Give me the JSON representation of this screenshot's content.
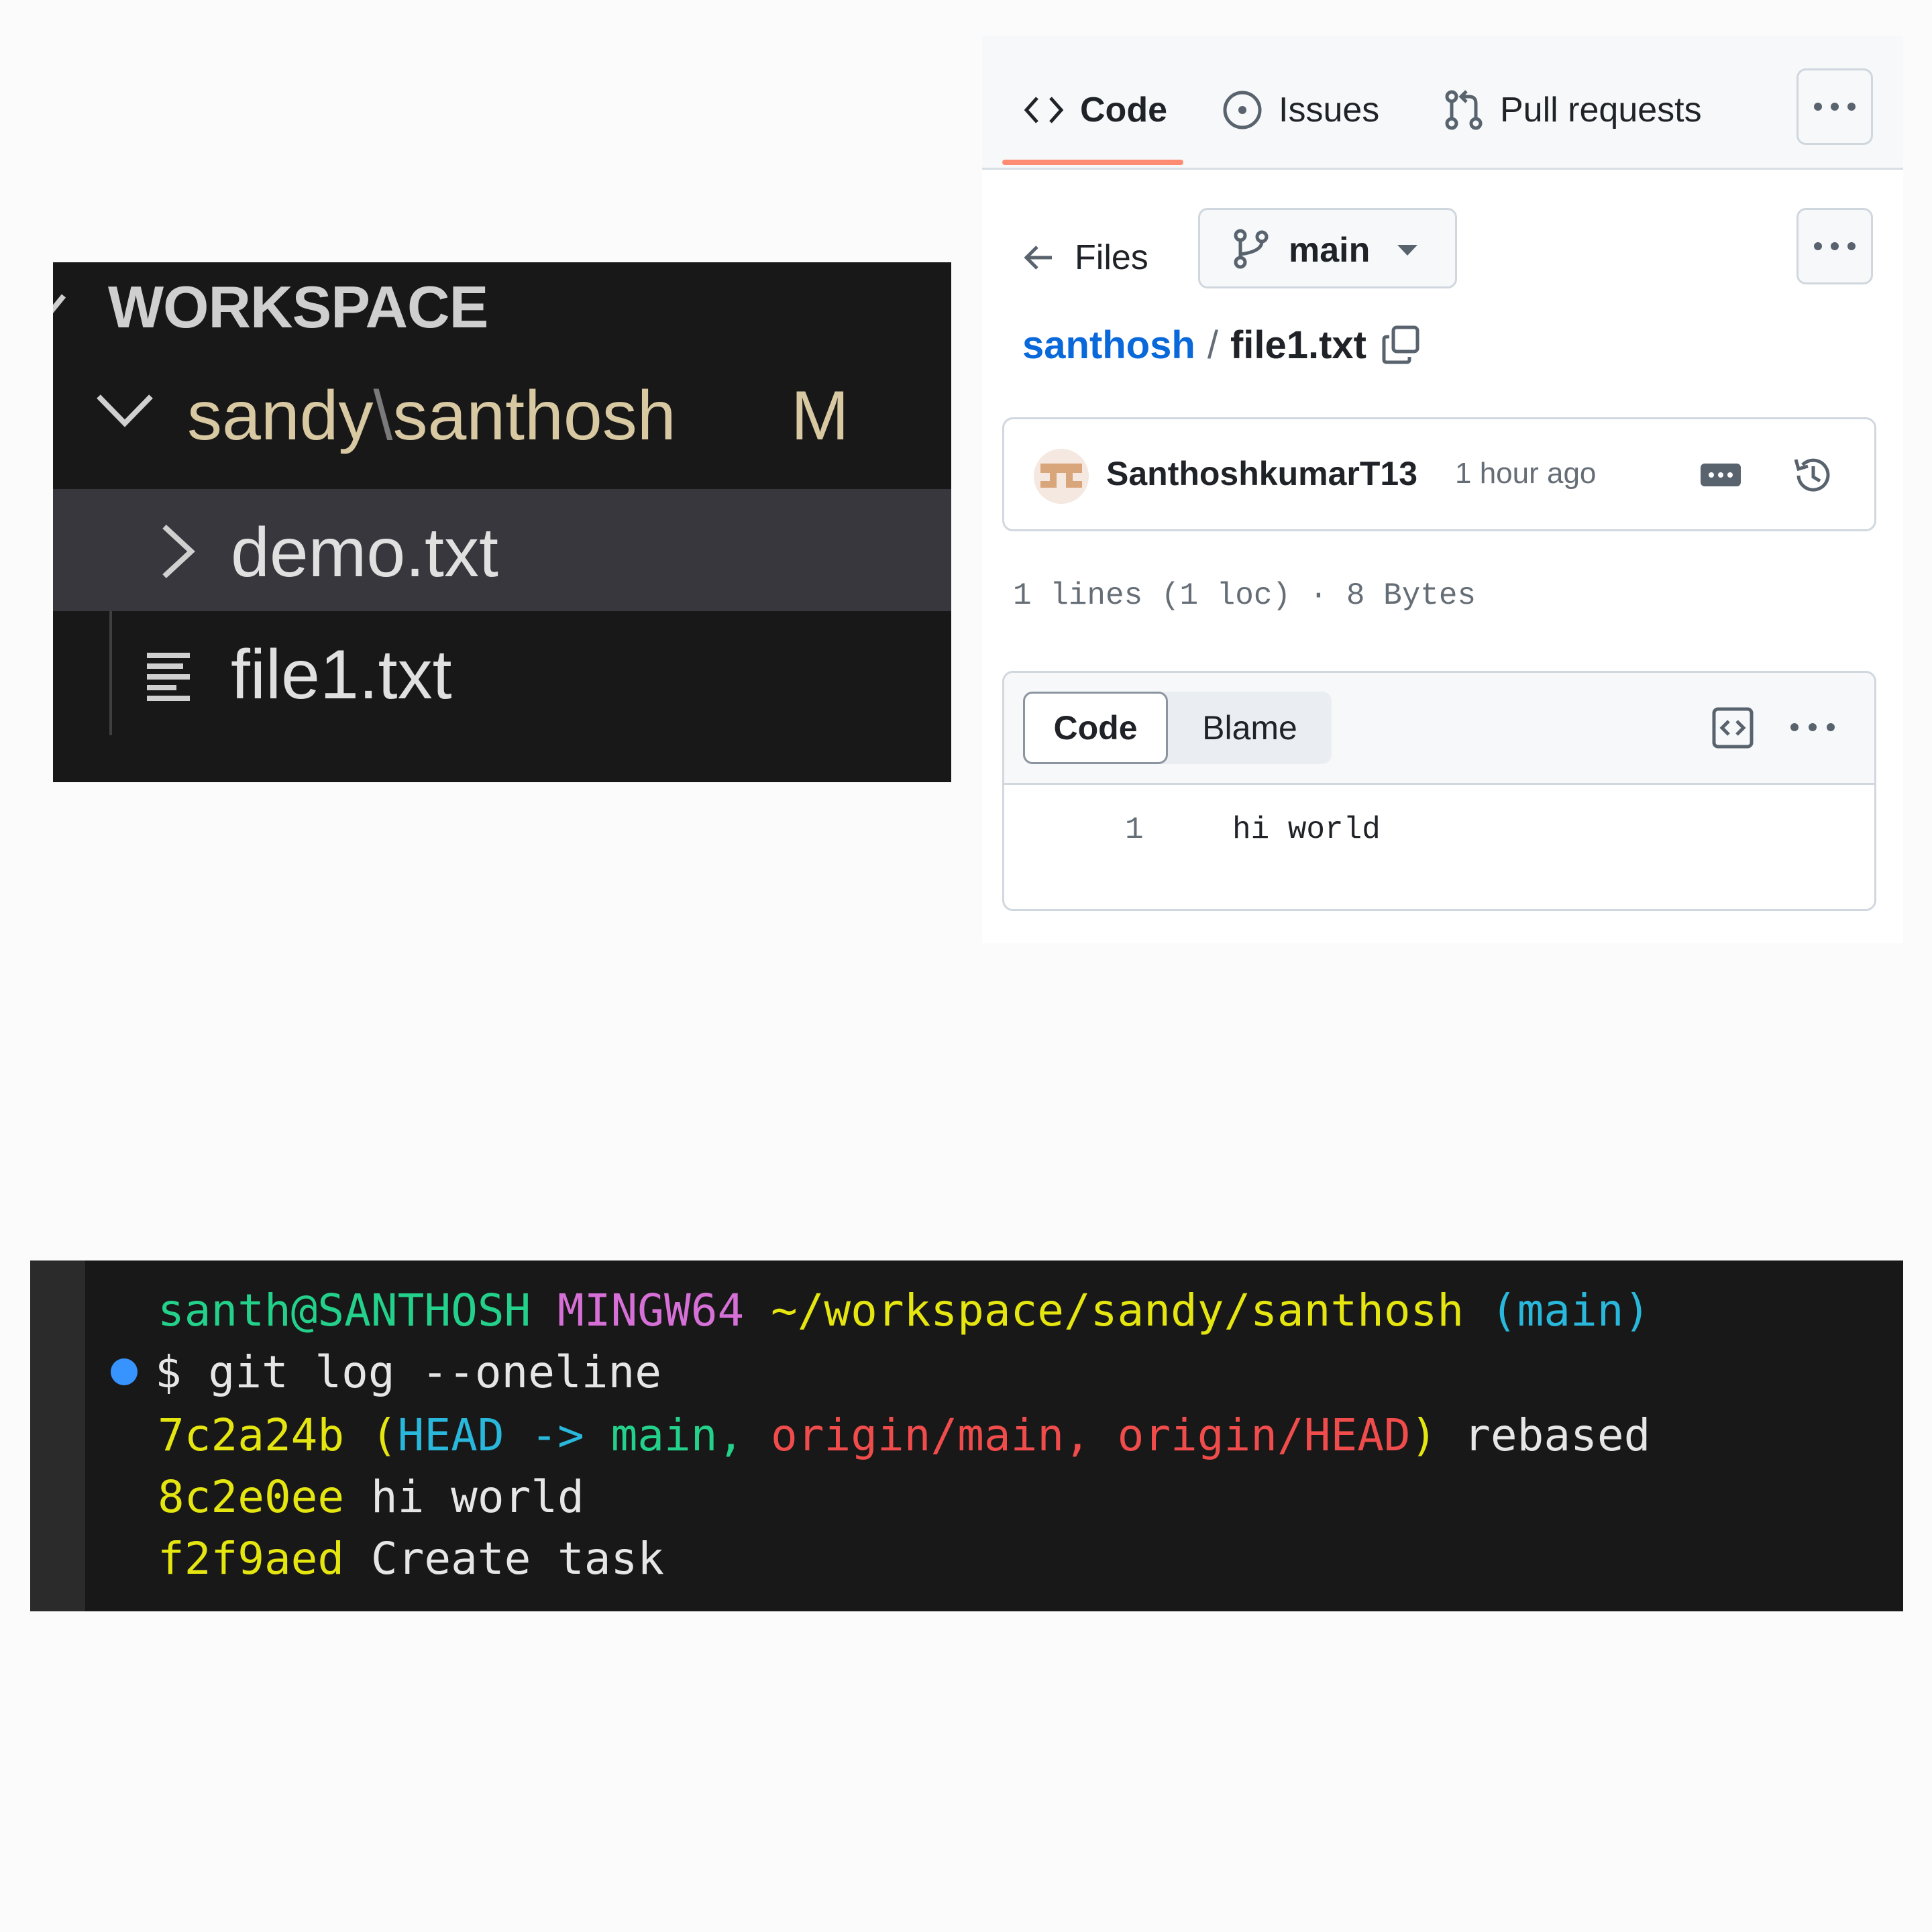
{
  "explorer": {
    "section_title": "WORKSPACE",
    "folder": {
      "label_left": "sandy",
      "separator": "\\",
      "label_right": "santhosh",
      "badge": "M"
    },
    "items": [
      {
        "name": "demo.txt",
        "kind": "folder-collapsed",
        "selected": true
      },
      {
        "name": "file1.txt",
        "kind": "file",
        "selected": false
      }
    ]
  },
  "github": {
    "tabs": [
      {
        "label": "Code",
        "icon": "code-icon",
        "active": true
      },
      {
        "label": "Issues",
        "icon": "issue-opened-icon",
        "active": false
      },
      {
        "label": "Pull requests",
        "icon": "git-pull-request-icon",
        "active": false
      }
    ],
    "files_label": "Files",
    "branch": "main",
    "breadcrumb": {
      "repo": "santhosh",
      "separator": "/",
      "file": "file1.txt"
    },
    "commit": {
      "author": "SanthoshkumarT13",
      "time": "1 hour ago"
    },
    "file_info": "1 lines (1 loc) · 8 Bytes",
    "view_tabs": {
      "code": "Code",
      "blame": "Blame"
    },
    "code_lines": [
      {
        "number": "1",
        "text": "hi world"
      }
    ],
    "accent_color": "#fd8c73",
    "link_color": "#0969da"
  },
  "terminal": {
    "prompt": {
      "user": "santh@SANTHOSH",
      "system": "MINGW64",
      "path": "~/workspace/sandy/santhosh",
      "branch": "(main)"
    },
    "command": "$ git log --oneline",
    "log": [
      {
        "hash": "7c2a24b",
        "refs_open": "(",
        "head": "HEAD ->",
        "main": "main,",
        "origin_main": "origin/main,",
        "origin_head": "origin/HEAD",
        "refs_close": ")",
        "message": "rebased"
      },
      {
        "hash": "8c2e0ee",
        "message": "hi world"
      },
      {
        "hash": "f2f9aed",
        "message": "Create task"
      }
    ]
  }
}
